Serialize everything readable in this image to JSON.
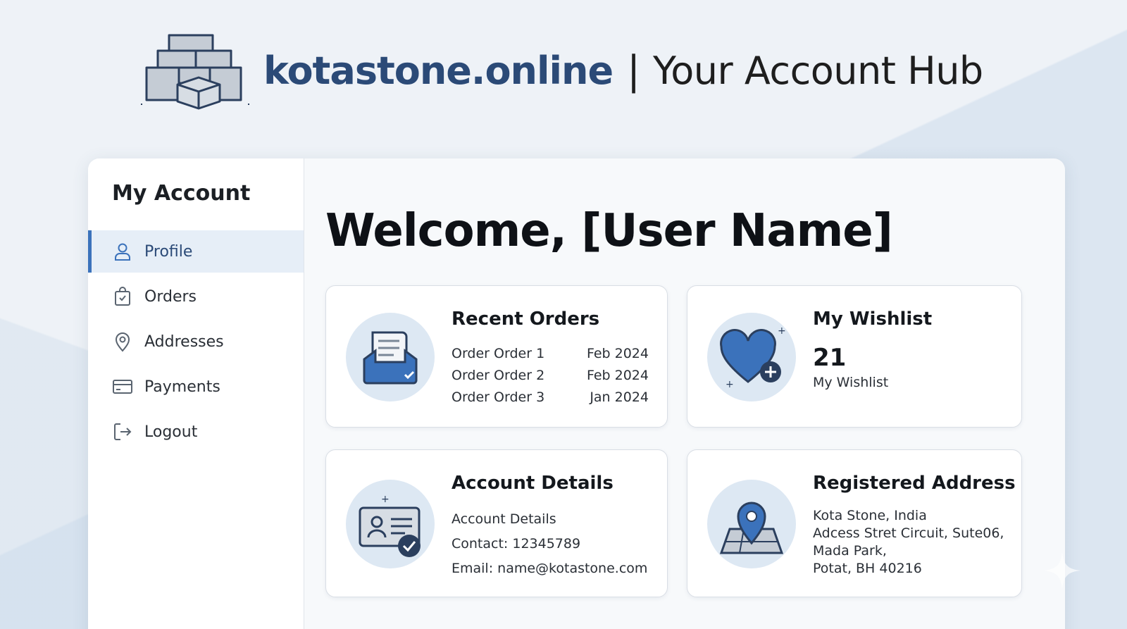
{
  "header": {
    "brand": "kotastone.online",
    "separator": "|",
    "tagline": "Your Account Hub"
  },
  "sidebar": {
    "title": "My Account",
    "items": [
      {
        "label": "Profile",
        "icon": "user-icon",
        "active": true
      },
      {
        "label": "Orders",
        "icon": "shopping-bag-icon",
        "active": false
      },
      {
        "label": "Addresses",
        "icon": "map-pin-icon",
        "active": false
      },
      {
        "label": "Payments",
        "icon": "credit-card-icon",
        "active": false
      },
      {
        "label": "Logout",
        "icon": "logout-icon",
        "active": false
      }
    ]
  },
  "main": {
    "welcome": "Welcome, [User Name]",
    "recent_orders": {
      "title": "Recent Orders",
      "icon": "inbox-document-icon",
      "orders": [
        {
          "name": "Order Order 1",
          "date": "Feb 2024"
        },
        {
          "name": "Order Order 2",
          "date": "Feb 2024"
        },
        {
          "name": "Order Order 3",
          "date": "Jan 2024"
        }
      ]
    },
    "wishlist": {
      "title": "My Wishlist",
      "icon": "heart-plus-icon",
      "count": "21",
      "label": "My Wishlist"
    },
    "account_details": {
      "title": "Account Details",
      "icon": "id-card-check-icon",
      "lines": [
        "Account Details",
        "Contact: 12345789",
        "Email: name@kotastone.com"
      ]
    },
    "registered_address": {
      "title": "Registered Address",
      "icon": "map-location-icon",
      "lines": [
        "Kota Stone, India",
        "Adcess Stret Circuit,  Sute06,",
        "Mada Park,",
        "Potat, BH 40216"
      ]
    }
  },
  "colors": {
    "brand": "#2b4a77",
    "accent": "#3b72bb",
    "icon_bg": "#dde8f3",
    "active_bg": "#e6eef7"
  }
}
